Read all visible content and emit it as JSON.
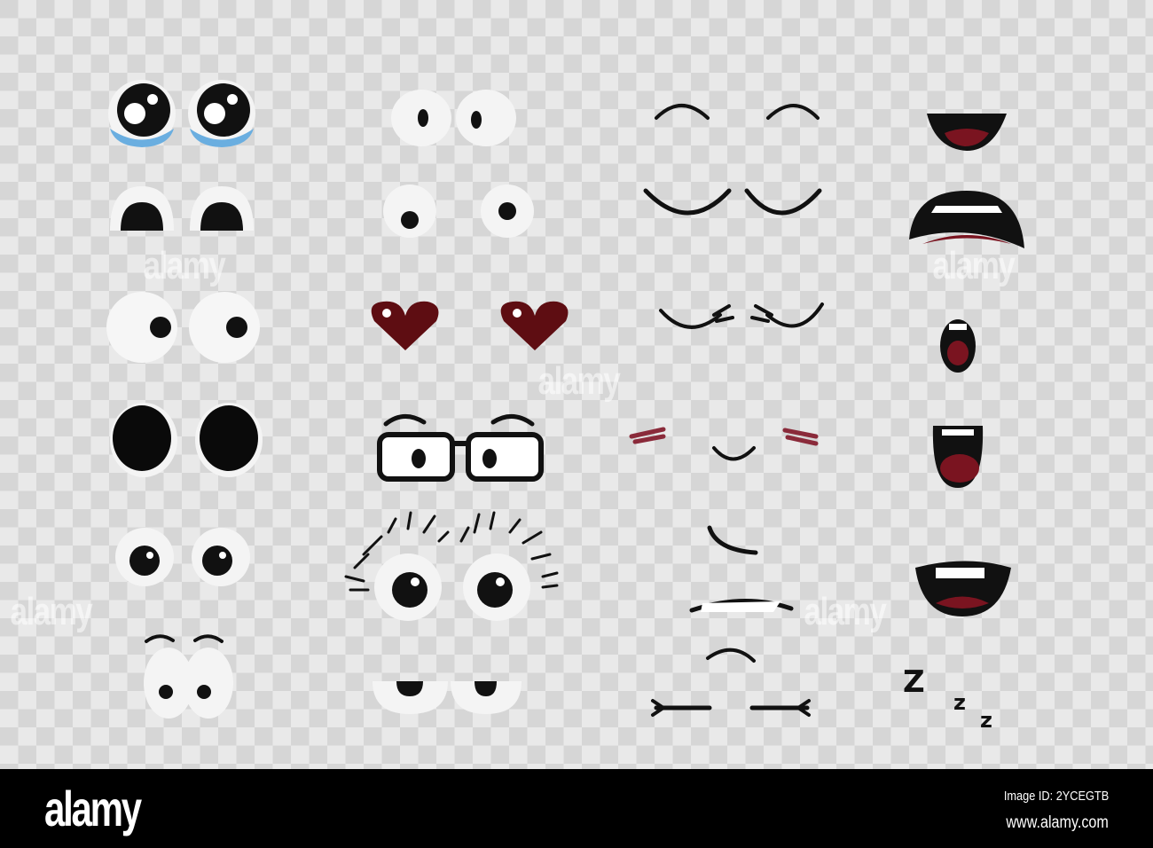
{
  "watermark": {
    "text": "alamy"
  },
  "sleep_letters": [
    "Z",
    "z",
    "z"
  ],
  "footer": {
    "logo": "alamy",
    "image_id": "Image ID: 2YCEGTB",
    "url": "www.alamy.com"
  },
  "colors": {
    "checker_light": "#e9e9e9",
    "checker_dark": "#d6d6d6",
    "mouth_red": "#7a1420",
    "heart_red": "#5e0d12",
    "tear_blue": "#6aaee0",
    "blush": "#8a2a3a"
  }
}
